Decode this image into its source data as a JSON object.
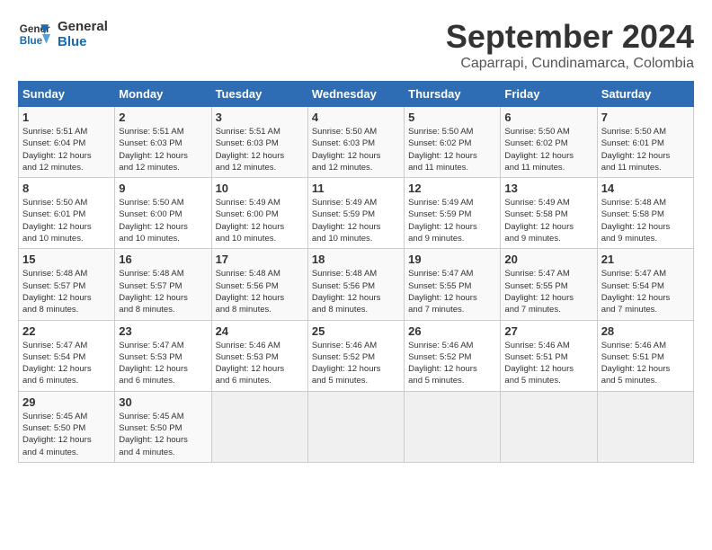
{
  "header": {
    "logo_line1": "General",
    "logo_line2": "Blue",
    "title": "September 2024",
    "subtitle": "Caparrapi, Cundinamarca, Colombia"
  },
  "calendar": {
    "headers": [
      "Sunday",
      "Monday",
      "Tuesday",
      "Wednesday",
      "Thursday",
      "Friday",
      "Saturday"
    ],
    "weeks": [
      [
        {
          "day": "",
          "info": ""
        },
        {
          "day": "2",
          "info": "Sunrise: 5:51 AM\nSunset: 6:03 PM\nDaylight: 12 hours\nand 12 minutes."
        },
        {
          "day": "3",
          "info": "Sunrise: 5:51 AM\nSunset: 6:03 PM\nDaylight: 12 hours\nand 12 minutes."
        },
        {
          "day": "4",
          "info": "Sunrise: 5:50 AM\nSunset: 6:03 PM\nDaylight: 12 hours\nand 12 minutes."
        },
        {
          "day": "5",
          "info": "Sunrise: 5:50 AM\nSunset: 6:02 PM\nDaylight: 12 hours\nand 11 minutes."
        },
        {
          "day": "6",
          "info": "Sunrise: 5:50 AM\nSunset: 6:02 PM\nDaylight: 12 hours\nand 11 minutes."
        },
        {
          "day": "7",
          "info": "Sunrise: 5:50 AM\nSunset: 6:01 PM\nDaylight: 12 hours\nand 11 minutes."
        }
      ],
      [
        {
          "day": "1",
          "info": "Sunrise: 5:51 AM\nSunset: 6:04 PM\nDaylight: 12 hours\nand 12 minutes."
        },
        {
          "day": "",
          "info": ""
        },
        {
          "day": "",
          "info": ""
        },
        {
          "day": "",
          "info": ""
        },
        {
          "day": "",
          "info": ""
        },
        {
          "day": "",
          "info": ""
        },
        {
          "day": "",
          "info": ""
        }
      ],
      [
        {
          "day": "8",
          "info": "Sunrise: 5:50 AM\nSunset: 6:01 PM\nDaylight: 12 hours\nand 10 minutes."
        },
        {
          "day": "9",
          "info": "Sunrise: 5:50 AM\nSunset: 6:00 PM\nDaylight: 12 hours\nand 10 minutes."
        },
        {
          "day": "10",
          "info": "Sunrise: 5:49 AM\nSunset: 6:00 PM\nDaylight: 12 hours\nand 10 minutes."
        },
        {
          "day": "11",
          "info": "Sunrise: 5:49 AM\nSunset: 5:59 PM\nDaylight: 12 hours\nand 10 minutes."
        },
        {
          "day": "12",
          "info": "Sunrise: 5:49 AM\nSunset: 5:59 PM\nDaylight: 12 hours\nand 9 minutes."
        },
        {
          "day": "13",
          "info": "Sunrise: 5:49 AM\nSunset: 5:58 PM\nDaylight: 12 hours\nand 9 minutes."
        },
        {
          "day": "14",
          "info": "Sunrise: 5:48 AM\nSunset: 5:58 PM\nDaylight: 12 hours\nand 9 minutes."
        }
      ],
      [
        {
          "day": "15",
          "info": "Sunrise: 5:48 AM\nSunset: 5:57 PM\nDaylight: 12 hours\nand 8 minutes."
        },
        {
          "day": "16",
          "info": "Sunrise: 5:48 AM\nSunset: 5:57 PM\nDaylight: 12 hours\nand 8 minutes."
        },
        {
          "day": "17",
          "info": "Sunrise: 5:48 AM\nSunset: 5:56 PM\nDaylight: 12 hours\nand 8 minutes."
        },
        {
          "day": "18",
          "info": "Sunrise: 5:48 AM\nSunset: 5:56 PM\nDaylight: 12 hours\nand 8 minutes."
        },
        {
          "day": "19",
          "info": "Sunrise: 5:47 AM\nSunset: 5:55 PM\nDaylight: 12 hours\nand 7 minutes."
        },
        {
          "day": "20",
          "info": "Sunrise: 5:47 AM\nSunset: 5:55 PM\nDaylight: 12 hours\nand 7 minutes."
        },
        {
          "day": "21",
          "info": "Sunrise: 5:47 AM\nSunset: 5:54 PM\nDaylight: 12 hours\nand 7 minutes."
        }
      ],
      [
        {
          "day": "22",
          "info": "Sunrise: 5:47 AM\nSunset: 5:54 PM\nDaylight: 12 hours\nand 6 minutes."
        },
        {
          "day": "23",
          "info": "Sunrise: 5:47 AM\nSunset: 5:53 PM\nDaylight: 12 hours\nand 6 minutes."
        },
        {
          "day": "24",
          "info": "Sunrise: 5:46 AM\nSunset: 5:53 PM\nDaylight: 12 hours\nand 6 minutes."
        },
        {
          "day": "25",
          "info": "Sunrise: 5:46 AM\nSunset: 5:52 PM\nDaylight: 12 hours\nand 5 minutes."
        },
        {
          "day": "26",
          "info": "Sunrise: 5:46 AM\nSunset: 5:52 PM\nDaylight: 12 hours\nand 5 minutes."
        },
        {
          "day": "27",
          "info": "Sunrise: 5:46 AM\nSunset: 5:51 PM\nDaylight: 12 hours\nand 5 minutes."
        },
        {
          "day": "28",
          "info": "Sunrise: 5:46 AM\nSunset: 5:51 PM\nDaylight: 12 hours\nand 5 minutes."
        }
      ],
      [
        {
          "day": "29",
          "info": "Sunrise: 5:45 AM\nSunset: 5:50 PM\nDaylight: 12 hours\nand 4 minutes."
        },
        {
          "day": "30",
          "info": "Sunrise: 5:45 AM\nSunset: 5:50 PM\nDaylight: 12 hours\nand 4 minutes."
        },
        {
          "day": "",
          "info": ""
        },
        {
          "day": "",
          "info": ""
        },
        {
          "day": "",
          "info": ""
        },
        {
          "day": "",
          "info": ""
        },
        {
          "day": "",
          "info": ""
        }
      ]
    ]
  }
}
